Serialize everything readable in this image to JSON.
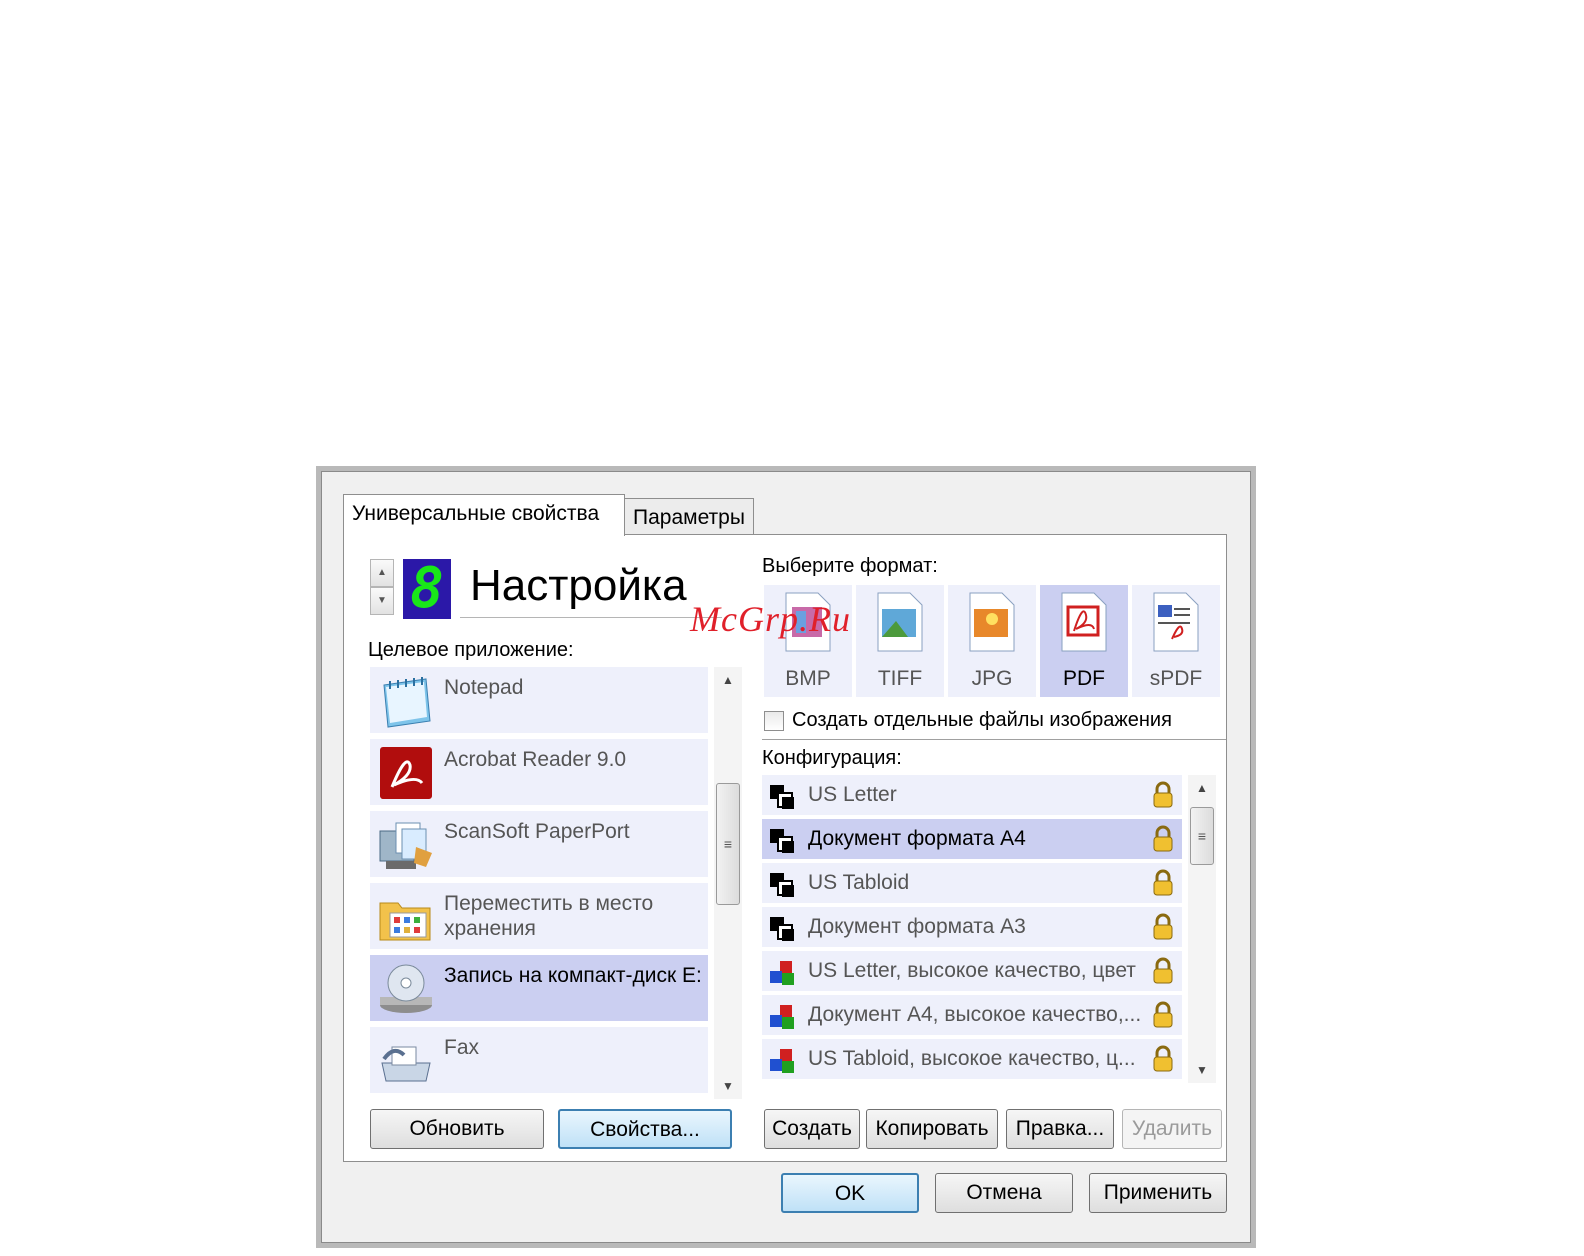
{
  "watermark": "McGrp.Ru",
  "tabs": [
    {
      "label": "Универсальные свойства",
      "active": true
    },
    {
      "label": "Параметры",
      "active": false
    }
  ],
  "config": {
    "number": "8",
    "name": "Настройка"
  },
  "target_app": {
    "label": "Целевое приложение:",
    "items": [
      {
        "label": "Notepad",
        "icon": "notepad-icon",
        "selected": false
      },
      {
        "label": "Acrobat Reader 9.0",
        "icon": "acrobat-icon",
        "selected": false
      },
      {
        "label": "ScanSoft PaperPort",
        "icon": "paperport-icon",
        "selected": false
      },
      {
        "label": "Переместить в место хранения",
        "icon": "folder-icon",
        "selected": false
      },
      {
        "label": "Запись на компакт-диск E:",
        "icon": "cd-burn-icon",
        "selected": true
      },
      {
        "label": "Fax",
        "icon": "fax-icon",
        "selected": false
      }
    ],
    "buttons": {
      "refresh": "Обновить",
      "properties": "Свойства..."
    }
  },
  "format": {
    "label": "Выберите формат:",
    "items": [
      {
        "label": "BMP",
        "icon": "bmp-file-icon",
        "selected": false
      },
      {
        "label": "TIFF",
        "icon": "tiff-file-icon",
        "selected": false
      },
      {
        "label": "JPG",
        "icon": "jpg-file-icon",
        "selected": false
      },
      {
        "label": "PDF",
        "icon": "pdf-file-icon",
        "selected": true
      },
      {
        "label": "sPDF",
        "icon": "spdf-file-icon",
        "selected": false
      }
    ],
    "separate_files": {
      "label": "Создать отдельные файлы изображения",
      "checked": false
    }
  },
  "configuration": {
    "label": "Конфигурация:",
    "items": [
      {
        "label": "US Letter",
        "icon": "bw-document-icon",
        "selected": false,
        "locked": true
      },
      {
        "label": "Документ формата А4",
        "icon": "bw-document-icon",
        "selected": true,
        "locked": true
      },
      {
        "label": "US Tabloid",
        "icon": "bw-document-icon",
        "selected": false,
        "locked": true
      },
      {
        "label": "Документ формата А3",
        "icon": "bw-document-icon",
        "selected": false,
        "locked": true
      },
      {
        "label": "US Letter, высокое качество, цвет",
        "icon": "color-document-icon",
        "selected": false,
        "locked": true
      },
      {
        "label": "Документ А4, высокое качество,...",
        "icon": "color-document-icon",
        "selected": false,
        "locked": true
      },
      {
        "label": "US Tabloid, высокое качество, ц...",
        "icon": "color-document-icon",
        "selected": false,
        "locked": true
      }
    ],
    "buttons": {
      "create": "Создать",
      "copy": "Копировать",
      "edit": "Правка...",
      "delete": "Удалить"
    }
  },
  "dialog_buttons": {
    "ok": "OK",
    "cancel": "Отмена",
    "apply": "Применить"
  }
}
